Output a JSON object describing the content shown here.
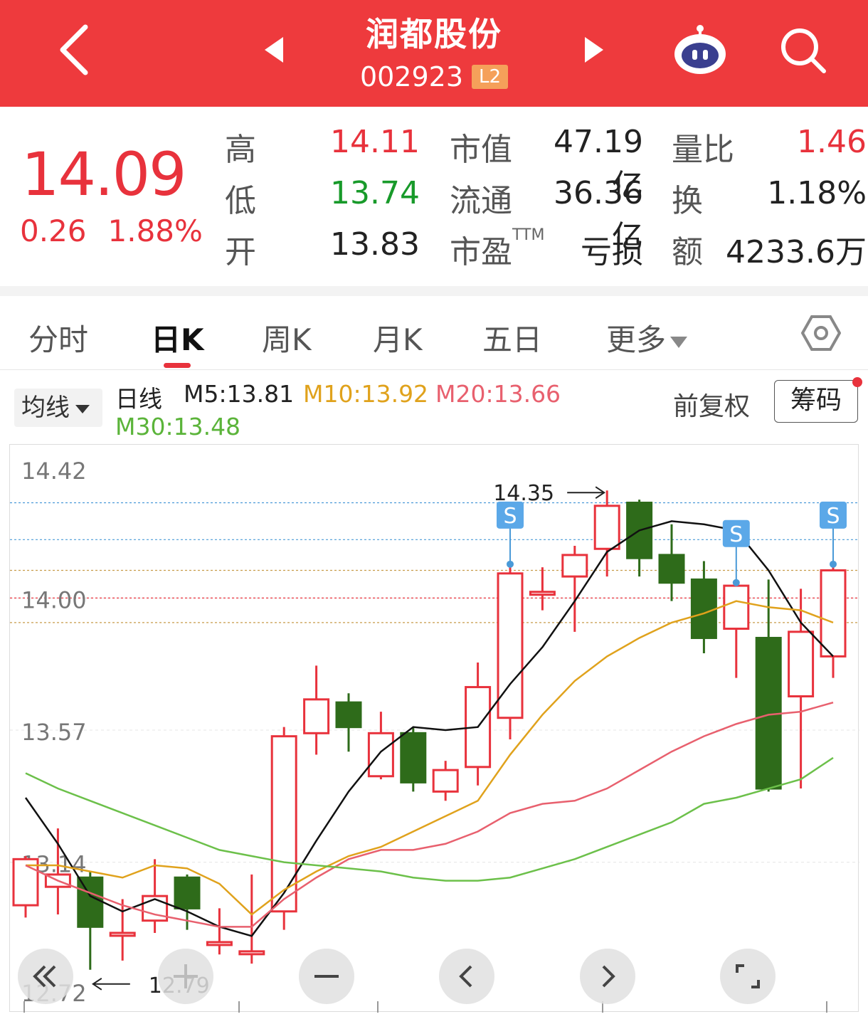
{
  "header": {
    "name": "润都股份",
    "code": "002923",
    "level_badge": "L2"
  },
  "quote": {
    "price": "14.09",
    "change": "0.26",
    "change_pct": "1.88%",
    "high_label": "高",
    "high": "14.11",
    "low_label": "低",
    "low": "13.74",
    "open_label": "开",
    "open": "13.83",
    "mcap_label": "市值",
    "mcap": "47.19亿",
    "float_label": "流通",
    "float": "36.36亿",
    "pe_label": "市盈",
    "pe_sup": "TTM",
    "pe": "亏损",
    "vol_ratio_label": "量比",
    "vol_ratio": "1.46",
    "turnover_label": "换",
    "turnover": "1.18%",
    "amount_label": "额",
    "amount": "4233.6万"
  },
  "tabs": [
    {
      "label": "分时"
    },
    {
      "label": "日K"
    },
    {
      "label": "周K"
    },
    {
      "label": "月K"
    },
    {
      "label": "五日"
    },
    {
      "label": "更多"
    }
  ],
  "ma": {
    "select": "均线",
    "period": "日线",
    "m5": "M5:13.81",
    "m10": "M10:13.92",
    "m20": "M20:13.66",
    "m30": "M30:13.48",
    "adjust": "前复权",
    "chips": "筹码"
  },
  "colors": {
    "up": "#e8323c",
    "down": "#2e6b1a",
    "m5": "#111111",
    "m10": "#e0a21c",
    "m20": "#e8606e",
    "m30": "#6cc04a"
  },
  "chart_data": {
    "type": "candlestick",
    "y_ticks": [
      "14.42",
      "14.00",
      "13.57",
      "13.14",
      "12.72"
    ],
    "ylim": [
      12.72,
      14.42
    ],
    "max_label": "14.35",
    "min_label": "12.79",
    "markers": [
      "S",
      "S",
      "S"
    ],
    "candles": [
      {
        "o": 13.0,
        "c": 13.15,
        "h": 13.16,
        "l": 12.96
      },
      {
        "o": 13.06,
        "c": 13.1,
        "h": 13.25,
        "l": 12.97
      },
      {
        "o": 13.09,
        "c": 12.93,
        "h": 13.11,
        "l": 12.79
      },
      {
        "o": 12.91,
        "c": 12.91,
        "h": 13.02,
        "l": 12.82
      },
      {
        "o": 12.95,
        "c": 13.03,
        "h": 13.15,
        "l": 12.91
      },
      {
        "o": 13.09,
        "c": 12.99,
        "h": 13.1,
        "l": 12.92
      },
      {
        "o": 12.88,
        "c": 12.88,
        "h": 12.99,
        "l": 12.84
      },
      {
        "o": 12.85,
        "c": 12.85,
        "h": 13.1,
        "l": 12.81
      },
      {
        "o": 12.98,
        "c": 13.55,
        "h": 13.58,
        "l": 12.92
      },
      {
        "o": 13.56,
        "c": 13.67,
        "h": 13.78,
        "l": 13.49
      },
      {
        "o": 13.66,
        "c": 13.58,
        "h": 13.69,
        "l": 13.5
      },
      {
        "o": 13.42,
        "c": 13.56,
        "h": 13.63,
        "l": 13.41
      },
      {
        "o": 13.56,
        "c": 13.4,
        "h": 13.58,
        "l": 13.37
      },
      {
        "o": 13.37,
        "c": 13.44,
        "h": 13.47,
        "l": 13.34
      },
      {
        "o": 13.45,
        "c": 13.71,
        "h": 13.79,
        "l": 13.39
      },
      {
        "o": 13.61,
        "c": 14.08,
        "h": 14.11,
        "l": 13.54
      },
      {
        "o": 14.02,
        "c": 14.02,
        "h": 14.1,
        "l": 13.96
      },
      {
        "o": 14.07,
        "c": 14.14,
        "h": 14.17,
        "l": 13.89
      },
      {
        "o": 14.16,
        "c": 14.3,
        "h": 14.35,
        "l": 14.07
      },
      {
        "o": 14.31,
        "c": 14.13,
        "h": 14.32,
        "l": 14.07
      },
      {
        "o": 14.14,
        "c": 14.05,
        "h": 14.24,
        "l": 13.99
      },
      {
        "o": 14.06,
        "c": 13.87,
        "h": 14.12,
        "l": 13.82
      },
      {
        "o": 13.9,
        "c": 14.04,
        "h": 14.05,
        "l": 13.74
      },
      {
        "o": 13.87,
        "c": 13.38,
        "h": 14.06,
        "l": 13.37
      },
      {
        "o": 13.68,
        "c": 13.89,
        "h": 14.03,
        "l": 13.38
      },
      {
        "o": 13.81,
        "c": 14.09,
        "h": 14.11,
        "l": 13.74
      }
    ],
    "series": [
      {
        "name": "M5",
        "values": [
          13.35,
          13.2,
          13.03,
          12.98,
          13.02,
          12.98,
          12.93,
          12.9,
          13.04,
          13.21,
          13.37,
          13.5,
          13.58,
          13.57,
          13.58,
          13.72,
          13.84,
          13.99,
          14.15,
          14.22,
          14.25,
          14.24,
          14.22,
          14.09,
          13.92,
          13.81
        ]
      },
      {
        "name": "M10",
        "values": [
          13.13,
          13.13,
          13.11,
          13.09,
          13.13,
          13.12,
          13.07,
          12.97,
          13.05,
          13.11,
          13.16,
          13.19,
          13.24,
          13.29,
          13.34,
          13.49,
          13.62,
          13.73,
          13.81,
          13.87,
          13.92,
          13.95,
          13.99,
          13.97,
          13.96,
          13.92
        ]
      },
      {
        "name": "M20",
        "values": [
          13.13,
          13.08,
          13.04,
          13.0,
          12.97,
          12.95,
          12.93,
          12.93,
          13.02,
          13.09,
          13.15,
          13.18,
          13.18,
          13.2,
          13.24,
          13.3,
          13.33,
          13.34,
          13.38,
          13.44,
          13.5,
          13.55,
          13.59,
          13.62,
          13.63,
          13.66
        ]
      },
      {
        "name": "M30",
        "values": [
          13.43,
          13.38,
          13.34,
          13.3,
          13.26,
          13.22,
          13.18,
          13.16,
          13.14,
          13.13,
          13.12,
          13.11,
          13.09,
          13.08,
          13.08,
          13.09,
          13.12,
          13.15,
          13.19,
          13.23,
          13.27,
          13.33,
          13.35,
          13.38,
          13.41,
          13.48
        ]
      }
    ]
  },
  "controls": [
    "rewind-icon",
    "zoom-in-icon",
    "zoom-out-icon",
    "left-icon",
    "right-icon",
    "fullscreen-icon"
  ]
}
